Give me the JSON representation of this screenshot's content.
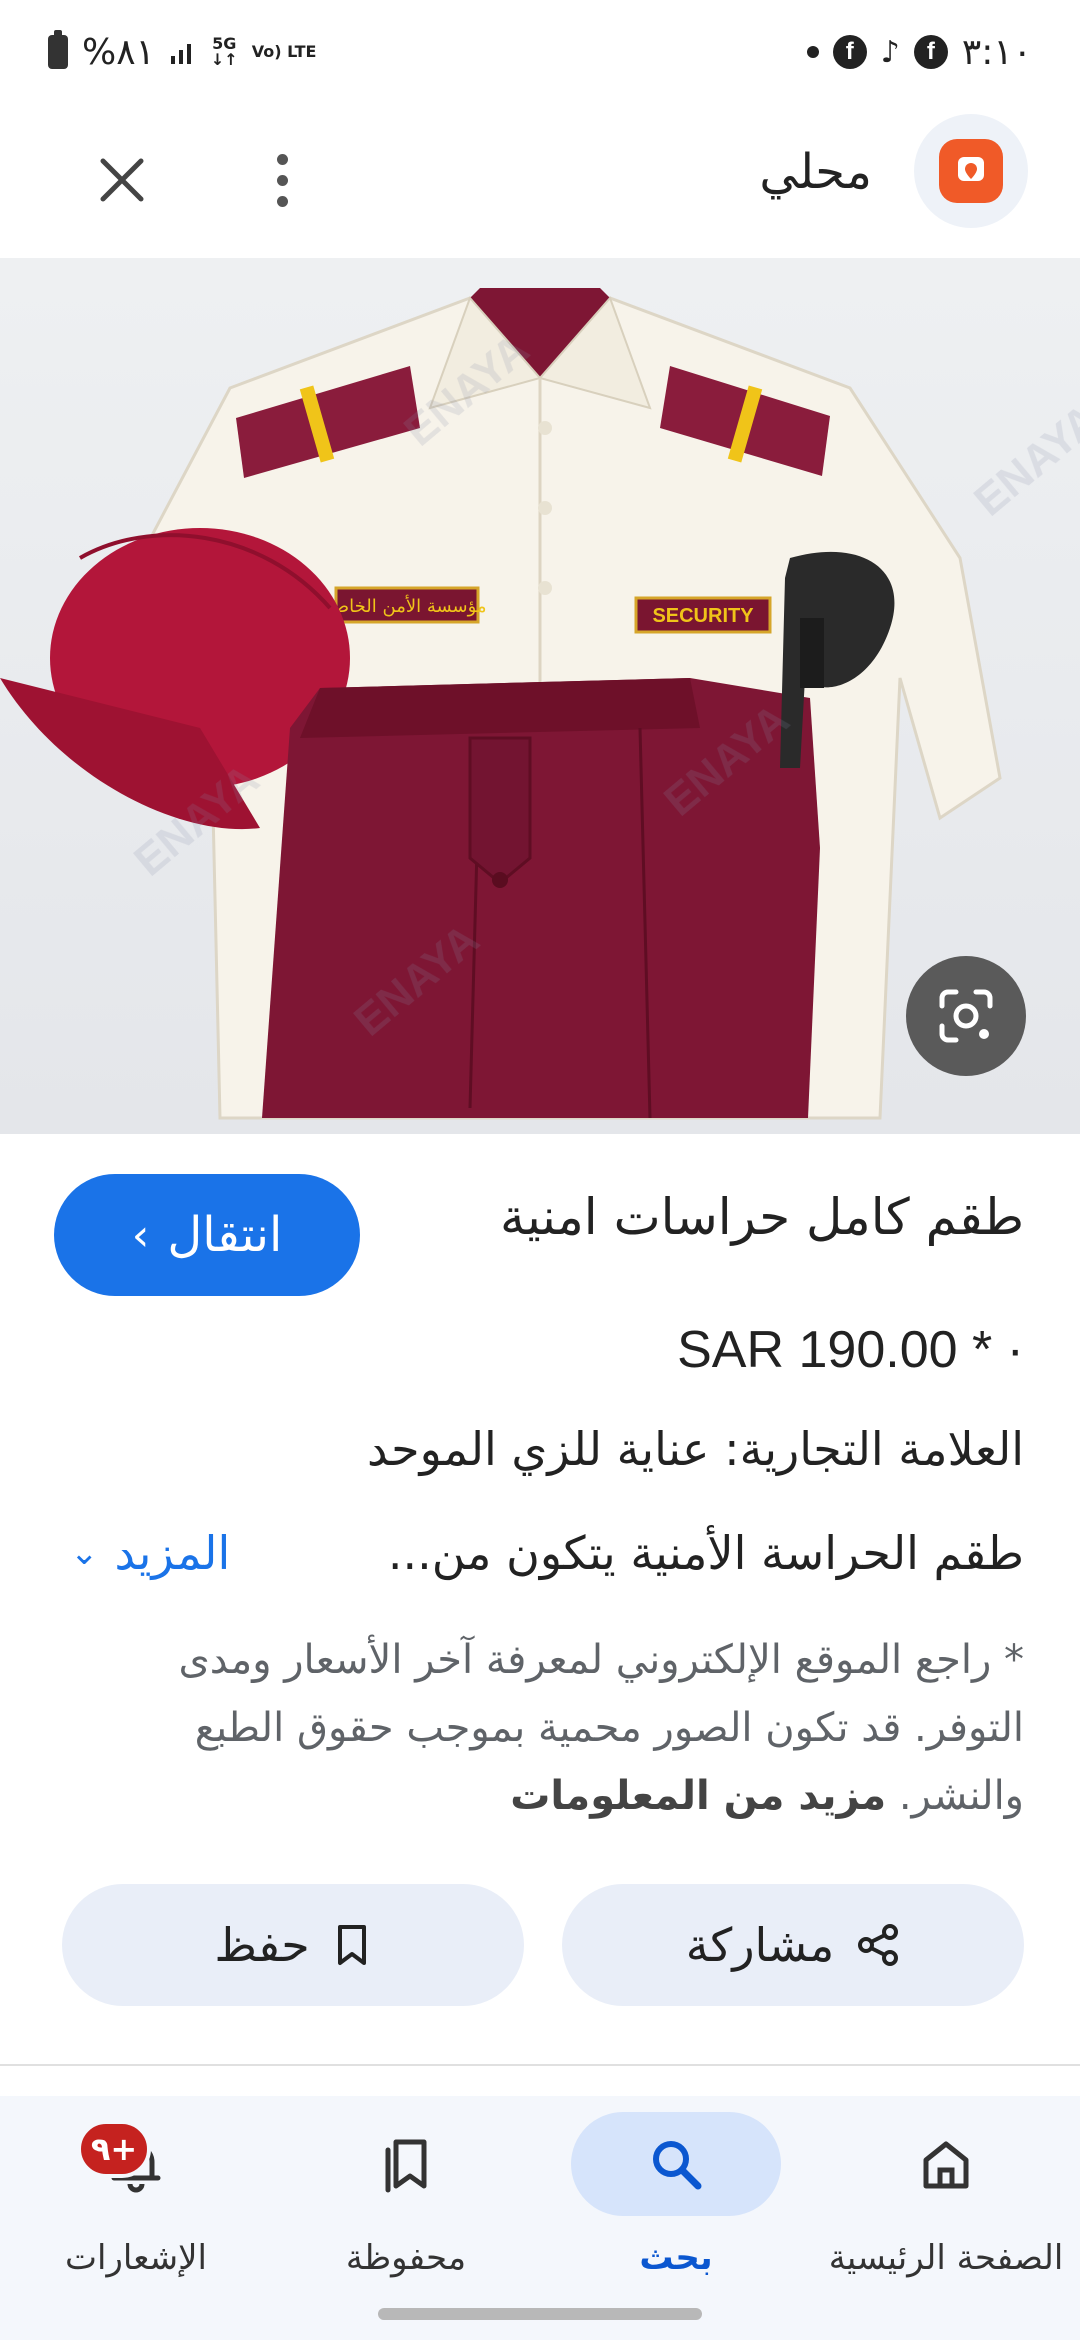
{
  "status_bar": {
    "time": "٣:١٠",
    "battery": "%٨١",
    "network_5g": "5G",
    "volte": "Vo) LTE"
  },
  "header": {
    "site_name": "محلي"
  },
  "product": {
    "title": "طقم كامل حراسات امنية",
    "go_label": "انتقال",
    "price": "SAR 190.00 * ·",
    "brand": "العلامة التجارية: عناية للزي الموحد",
    "description": "طقم الحراسة الأمنية يتكون من...",
    "more_label": "المزيد",
    "notice": "* راجع الموقع الإلكتروني لمعرفة آخر الأسعار ومدى التوفر. قد تكون الصور محمية بموجب حقوق الطبع والنشر.",
    "notice_link": "مزيد من المعلومات",
    "image_texts": {
      "badge_security": "SECURITY",
      "badge_arabic": "مؤسسة الأمن الخاص",
      "watermark": "ENAYA"
    }
  },
  "actions": {
    "share_label": "مشاركة",
    "save_label": "حفظ"
  },
  "bottom_nav": {
    "home": "الصفحة الرئيسية",
    "search": "بحث",
    "saved": "محفوظة",
    "notifications": "الإشعارات",
    "notif_badge": "+٩"
  },
  "colors": {
    "accent": "#1a73e8",
    "maroon": "#8a1c3c",
    "badge_red": "#c5221f",
    "logo_orange": "#f05a28"
  }
}
